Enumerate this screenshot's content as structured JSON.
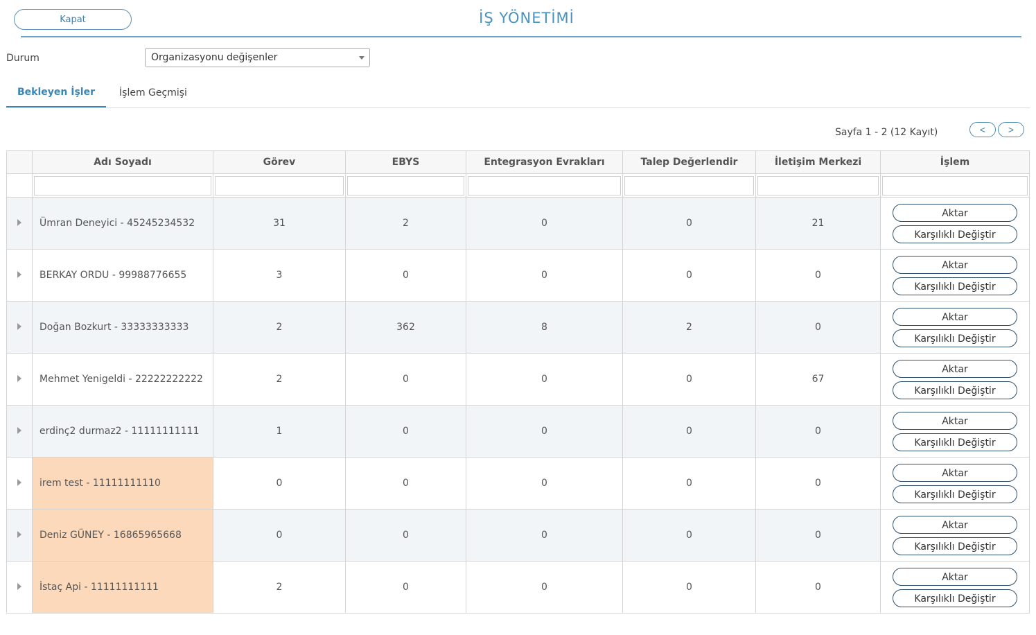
{
  "header": {
    "close_label": "Kapat",
    "title": "İŞ YÖNETİMİ"
  },
  "filter": {
    "status_label": "Durum",
    "status_value": "Organizasyonu değişenler"
  },
  "tabs": [
    {
      "label": "Bekleyen İşler",
      "active": true
    },
    {
      "label": "İşlem Geçmişi",
      "active": false
    }
  ],
  "pager": {
    "text": "Sayfa 1 - 2 (12 Kayıt)",
    "prev": "<",
    "next": ">"
  },
  "table": {
    "columns": [
      "Adı Soyadı",
      "Görev",
      "EBYS",
      "Entegrasyon Evrakları",
      "Talep Değerlendir",
      "İletişim Merkezi",
      "İşlem"
    ],
    "action_labels": {
      "transfer": "Aktar",
      "swap": "Karşılıklı Değiştir"
    },
    "rows": [
      {
        "name": "Ümran Deneyici - 45245234532",
        "gorev": "31",
        "ebys": "2",
        "entegrasyon": "0",
        "talep": "0",
        "iletisim": "21",
        "highlight": false
      },
      {
        "name": "BERKAY ORDU - 99988776655",
        "gorev": "3",
        "ebys": "0",
        "entegrasyon": "0",
        "talep": "0",
        "iletisim": "0",
        "highlight": false
      },
      {
        "name": "Doğan Bozkurt - 33333333333",
        "gorev": "2",
        "ebys": "362",
        "entegrasyon": "8",
        "talep": "2",
        "iletisim": "0",
        "highlight": false
      },
      {
        "name": "Mehmet Yenigeldi - 22222222222",
        "gorev": "2",
        "ebys": "0",
        "entegrasyon": "0",
        "talep": "0",
        "iletisim": "67",
        "highlight": false
      },
      {
        "name": "erdinç2 durmaz2 - 11111111111",
        "gorev": "1",
        "ebys": "0",
        "entegrasyon": "0",
        "talep": "0",
        "iletisim": "0",
        "highlight": false
      },
      {
        "name": "irem test - 11111111110",
        "gorev": "0",
        "ebys": "0",
        "entegrasyon": "0",
        "talep": "0",
        "iletisim": "0",
        "highlight": true
      },
      {
        "name": "Deniz GÜNEY - 16865965668",
        "gorev": "0",
        "ebys": "0",
        "entegrasyon": "0",
        "talep": "0",
        "iletisim": "0",
        "highlight": true
      },
      {
        "name": "İstaç Api - 11111111111",
        "gorev": "2",
        "ebys": "0",
        "entegrasyon": "0",
        "talep": "0",
        "iletisim": "0",
        "highlight": true
      }
    ]
  },
  "colors": {
    "accent": "#3b86b3",
    "highlight": "#fdd9bb",
    "row_alt": "#f1f5f8"
  }
}
